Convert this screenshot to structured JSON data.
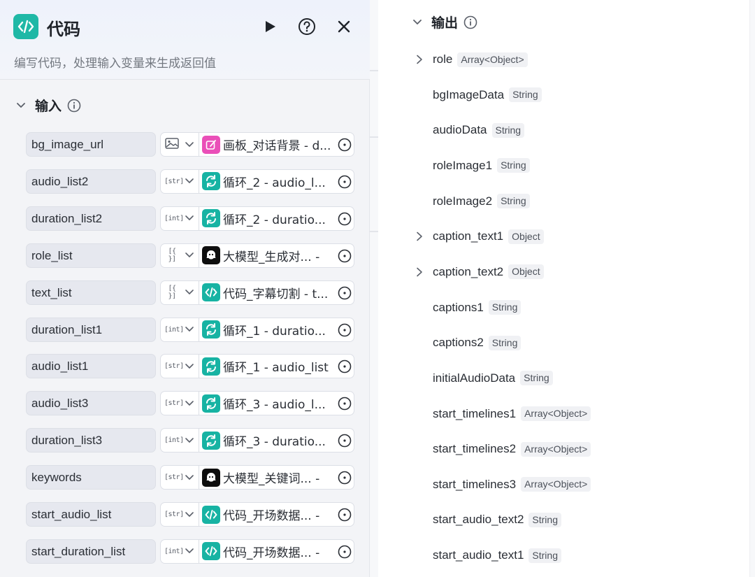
{
  "node": {
    "title": "代码",
    "description": "编写代码，处理输入变量来生成返回值",
    "icon": "code-icon",
    "accent": "#1fb8a6"
  },
  "input_section": {
    "title": "输入",
    "icon": "info-icon"
  },
  "inputs": [
    {
      "name": "bg_image_url",
      "type": "image",
      "source_icon": "canvas",
      "source_label": "画板_对话背景 - d..."
    },
    {
      "name": "audio_list2",
      "type": "str",
      "source_icon": "loop",
      "source_label": "循环_2 - audio_l..."
    },
    {
      "name": "duration_list2",
      "type": "int",
      "source_icon": "loop",
      "source_label": "循环_2 - duratio..."
    },
    {
      "name": "role_list",
      "type": "{ }",
      "source_icon": "llm",
      "source_label": "大模型_生成对... -"
    },
    {
      "name": "text_list",
      "type": "{ }",
      "source_icon": "code",
      "source_label": "代码_字幕切割 - t..."
    },
    {
      "name": "duration_list1",
      "type": "int",
      "source_icon": "loop",
      "source_label": "循环_1 - duratio..."
    },
    {
      "name": "audio_list1",
      "type": "str",
      "source_icon": "loop",
      "source_label": "循环_1 - audio_list"
    },
    {
      "name": "audio_list3",
      "type": "str",
      "source_icon": "loop",
      "source_label": "循环_3 - audio_l..."
    },
    {
      "name": "duration_list3",
      "type": "int",
      "source_icon": "loop",
      "source_label": "循环_3 - duratio..."
    },
    {
      "name": "keywords",
      "type": "str",
      "source_icon": "llm",
      "source_label": "大模型_关键词... -"
    },
    {
      "name": "start_audio_list",
      "type": "str",
      "source_icon": "code",
      "source_label": "代码_开场数据... -"
    },
    {
      "name": "start_duration_list",
      "type": "int",
      "source_icon": "code",
      "source_label": "代码_开场数据... -"
    }
  ],
  "output_section": {
    "title": "输出",
    "icon": "info-icon"
  },
  "outputs": [
    {
      "name": "role",
      "type": "Array<Object>",
      "expandable": true
    },
    {
      "name": "bgImageData",
      "type": "String",
      "expandable": false
    },
    {
      "name": "audioData",
      "type": "String",
      "expandable": false
    },
    {
      "name": "roleImage1",
      "type": "String",
      "expandable": false
    },
    {
      "name": "roleImage2",
      "type": "String",
      "expandable": false
    },
    {
      "name": "caption_text1",
      "type": "Object",
      "expandable": true
    },
    {
      "name": "caption_text2",
      "type": "Object",
      "expandable": true
    },
    {
      "name": "captions1",
      "type": "String",
      "expandable": false
    },
    {
      "name": "captions2",
      "type": "String",
      "expandable": false
    },
    {
      "name": "initialAudioData",
      "type": "String",
      "expandable": false
    },
    {
      "name": "start_timelines1",
      "type": "Array<Object>",
      "expandable": false
    },
    {
      "name": "start_timelines2",
      "type": "Array<Object>",
      "expandable": false
    },
    {
      "name": "start_timelines3",
      "type": "Array<Object>",
      "expandable": false
    },
    {
      "name": "start_audio_text2",
      "type": "String",
      "expandable": false
    },
    {
      "name": "start_audio_text1",
      "type": "String",
      "expandable": false
    }
  ]
}
